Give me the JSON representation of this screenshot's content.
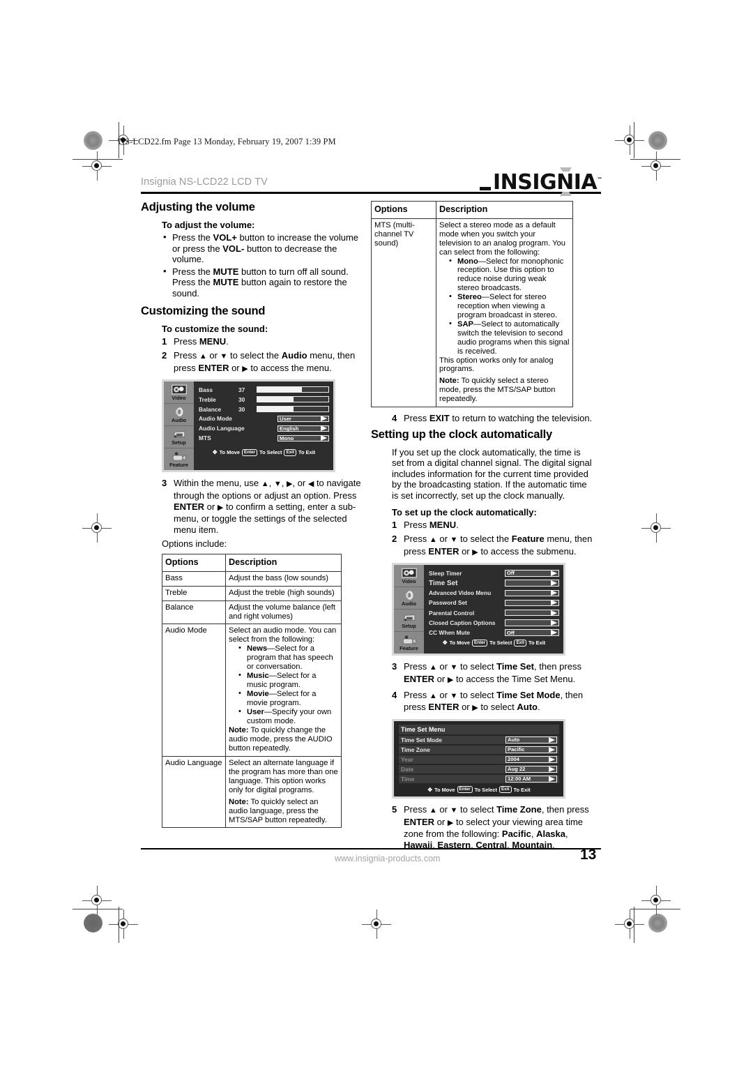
{
  "page": {
    "slug": "NS-LCD22.fm  Page 13  Monday, February 19, 2007  1:39 PM",
    "running_head": "Insignia NS-LCD22 LCD TV",
    "brand": "INSIGNIA",
    "brand_tm": "™",
    "footer_url": "www.insignia-products.com",
    "page_number": "13"
  },
  "left": {
    "h_volume": "Adjusting the volume",
    "sub_volume": "To adjust the volume:",
    "volume_bullets": [
      "Press the VOL+ button to increase the volume or press the VOL- button to decrease the volume.",
      "Press the MUTE button to turn off all sound. Press the MUTE button again to restore the sound."
    ],
    "h_sound": "Customizing the sound",
    "sub_sound": "To customize the sound:",
    "step1": "Press MENU.",
    "step1_num": "1",
    "step2_num": "2",
    "step2": "Press ▲ or ▼ to select the Audio menu, then press ENTER or ▶ to access the menu.",
    "step3_num": "3",
    "step3": "Within the menu, use ▲, ▼, ▶, or ◀ to navigate through the options or adjust an option. Press ENTER or ▶ to confirm a setting, enter a sub-menu, or toggle the settings of the selected menu item.",
    "options_include": "Options include:"
  },
  "audio_menu": {
    "sidebar": [
      "Video",
      "Audio",
      "Setup",
      "Feature"
    ],
    "rows": [
      {
        "name": "Bass",
        "value": "37",
        "fill": 63,
        "type": "bar"
      },
      {
        "name": "Treble",
        "value": "30",
        "fill": 51,
        "type": "bar"
      },
      {
        "name": "Balance",
        "value": "30",
        "fill": 51,
        "type": "bar"
      },
      {
        "name": "Audio Mode",
        "value": "User",
        "type": "select"
      },
      {
        "name": "Audio Language",
        "value": "English",
        "type": "select"
      },
      {
        "name": "MTS",
        "value": "Mono",
        "type": "select"
      }
    ],
    "hint_move": "To Move",
    "hint_enter": "Enter",
    "hint_select": "To Select",
    "hint_exit": "Exit",
    "hint_toexit": "To Exit"
  },
  "table_left": {
    "headers": [
      "Options",
      "Description"
    ],
    "rows": [
      {
        "option": "Bass",
        "desc": "Adjust the bass (low sounds)"
      },
      {
        "option": "Treble",
        "desc": "Adjust the treble (high sounds)"
      },
      {
        "option": "Balance",
        "desc": "Adjust the volume balance (left and right volumes)"
      },
      {
        "option": "Audio Mode",
        "desc": "Select an audio mode. You can select from the following:",
        "bullets": [
          {
            "term": "News",
            "text": "—Select for a program that has speech or conversation."
          },
          {
            "term": "Music",
            "text": "—Select for a music program."
          },
          {
            "term": "Movie",
            "text": "—Select for a movie program."
          },
          {
            "term": "User",
            "text": "—Specify your own custom mode."
          }
        ],
        "note_label": "Note:",
        "note": " To quickly change the audio mode, press the AUDIO button repeatedly."
      },
      {
        "option": "Audio Language",
        "desc": "Select an alternate language if the program has more than one language. This option works only for digital programs.",
        "note_label": "Note:",
        "note": " To quickly select an audio language, press the MTS/SAP button repeatedly."
      }
    ]
  },
  "table_right": {
    "headers": [
      "Options",
      "Description"
    ],
    "row": {
      "option": "MTS (multi-channel TV sound)",
      "desc": "Select a stereo mode as a default mode when you switch your television to an analog program. You can select from the following:",
      "bullets": [
        {
          "term": "Mono",
          "text": "—Select for monophonic reception. Use this option to reduce noise during weak stereo broadcasts."
        },
        {
          "term": "Stereo",
          "text": "—Select for stereo reception when viewing a program broadcast in stereo."
        },
        {
          "term": "SAP",
          "text": "—Select to automatically switch the television to second audio programs when this signal is received."
        }
      ],
      "tail": "This option works only for analog programs.",
      "note_label": "Note:",
      "note": " To quickly select a stereo mode, press the MTS/SAP button repeatedly."
    }
  },
  "right": {
    "step4_num": "4",
    "step4": "Press EXIT to return to watching the television.",
    "h_clock": "Setting up the clock automatically",
    "clock_para": "If you set up the clock automatically, the time is set from a digital channel signal. The digital signal includes information for the current time provided by the broadcasting station. If the automatic time is set incorrectly, set up the clock manually.",
    "sub_clock": "To set up the clock automatically:",
    "c1_num": "1",
    "c1": "Press MENU.",
    "c2_num": "2",
    "c2": "Press ▲ or ▼ to select the Feature menu, then press ENTER or ▶ to access the submenu.",
    "c3_num": "3",
    "c3": "Press ▲ or ▼ to select Time Set, then press ENTER or ▶ to access the Time Set Menu.",
    "c4_num": "4",
    "c4": "Press ▲ or ▼ to select Time Set Mode, then press ENTER or ▶ to select Auto.",
    "c5_num": "5",
    "c5": "Press ▲ or ▼ to select Time Zone, then press ENTER or ▶ to select your viewing area time zone from the following: Pacific, Alaska, Hawaii, Eastern, Central, Mountain."
  },
  "feature_menu": {
    "sidebar": [
      "Video",
      "Audio",
      "Setup",
      "Feature"
    ],
    "rows": [
      {
        "name": "Sleep Timer",
        "value": "Off",
        "selected": false
      },
      {
        "name": "Time Set",
        "value": "",
        "selected": true
      },
      {
        "name": "Advanced Video Menu",
        "value": "",
        "selected": false
      },
      {
        "name": "Password Set",
        "value": "",
        "selected": false
      },
      {
        "name": "Parental Control",
        "value": "",
        "selected": false
      },
      {
        "name": "Closed Caption Options",
        "value": "",
        "selected": false
      },
      {
        "name": "CC When Mute",
        "value": "Off",
        "selected": false
      }
    ]
  },
  "timeset_menu": {
    "title": "Time Set Menu",
    "rows": [
      {
        "name": "Time Set Mode",
        "value": "Auto",
        "dim": false
      },
      {
        "name": "Time Zone",
        "value": "Pacific",
        "dim": false
      },
      {
        "name": "Year",
        "value": "2004",
        "dim": true
      },
      {
        "name": "Date",
        "value": "Aug 22",
        "dim": true
      },
      {
        "name": "Time",
        "value": "12:00  AM",
        "dim": true
      }
    ]
  }
}
